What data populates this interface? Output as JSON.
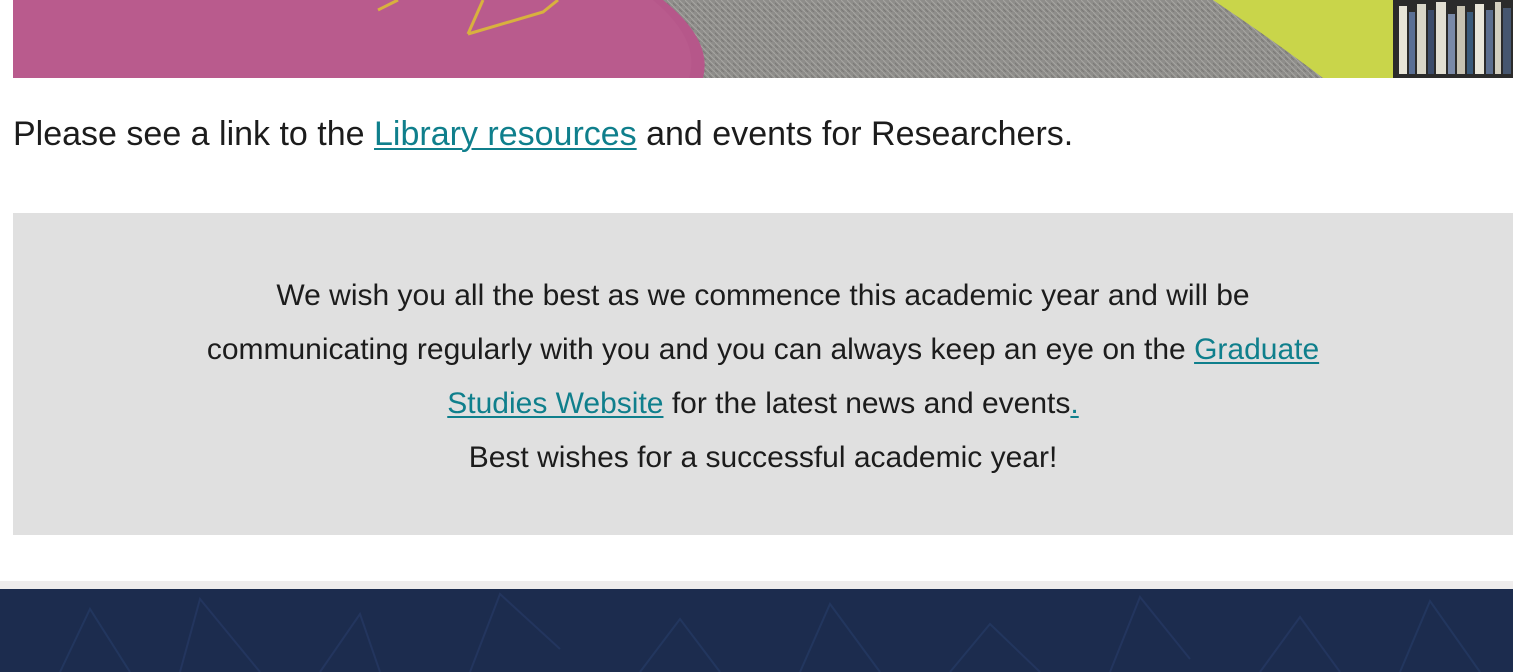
{
  "hero": {
    "image_icon": "library-photo-image"
  },
  "intro": {
    "text_before": "Please see a link to the ",
    "link_label": "Library resources",
    "text_after": " and events for Researchers."
  },
  "notice": {
    "line1": "We wish you all the best as we commence this academic year and will be",
    "line2_before": "communicating regularly with you and you can always keep an eye on the ",
    "link_label_part1": "Graduate",
    "link_label_part2": "Studies Website",
    "line3_after": " for the latest news and events",
    "period_link": ".",
    "closing": "Best wishes for a successful academic year!"
  },
  "colors": {
    "link": "#0f7f8c",
    "notice_bg": "#e0e0e0",
    "footer_bg": "#1c2c4e",
    "text": "#1c1c1c"
  }
}
